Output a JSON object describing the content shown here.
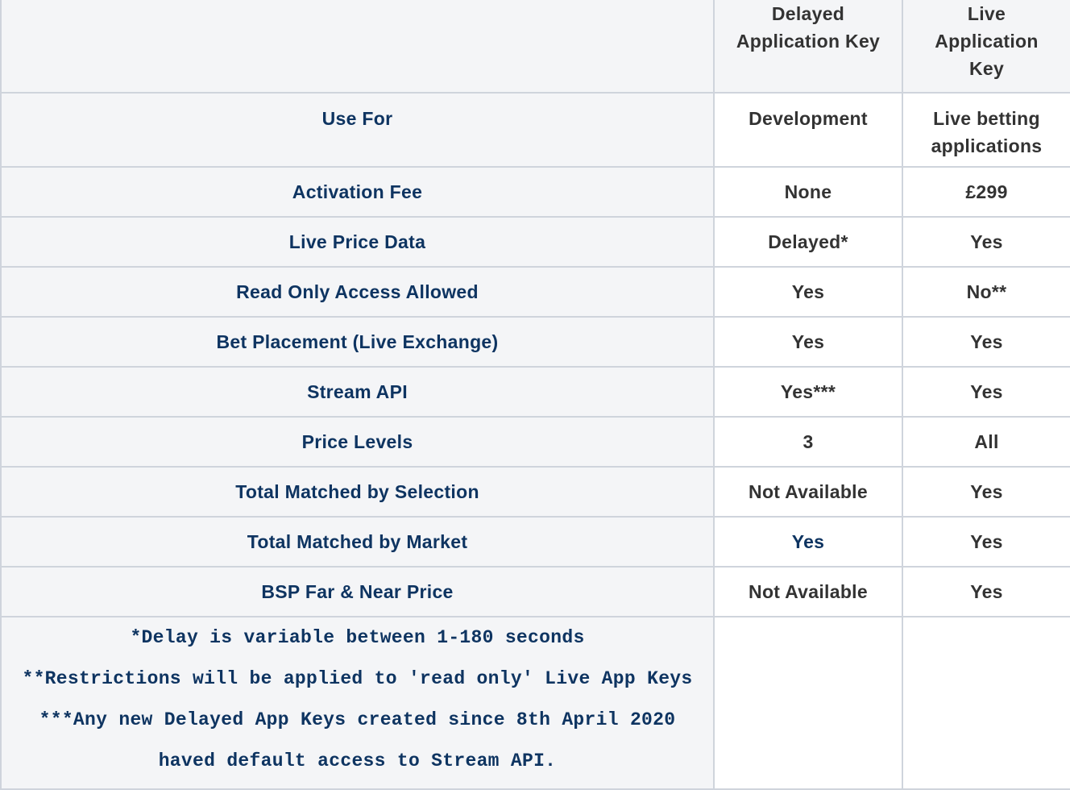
{
  "table": {
    "headers": {
      "corner": "",
      "delayed": [
        "Delayed",
        "Application Key"
      ],
      "live": [
        "Live",
        "Application",
        "Key"
      ]
    },
    "use_for": {
      "label": "Use For",
      "delayed": "Development",
      "live": [
        "Live betting",
        "applications"
      ]
    },
    "rows": [
      {
        "label": "Activation Fee",
        "delayed": "None",
        "live": "£299"
      },
      {
        "label": "Live Price Data",
        "delayed": "Delayed*",
        "live": "Yes"
      },
      {
        "label": "Read Only Access Allowed",
        "delayed": "Yes",
        "live": "No**"
      },
      {
        "label": "Bet Placement (Live Exchange)",
        "delayed": "Yes",
        "live": "Yes"
      },
      {
        "label": "Stream API",
        "delayed": "Yes***",
        "live": "Yes"
      },
      {
        "label": "Price Levels",
        "delayed": "3",
        "live": "All"
      },
      {
        "label": "Total Matched by Selection",
        "delayed": "Not Available",
        "live": "Yes"
      },
      {
        "label": "Total Matched by Market",
        "delayed": "Yes",
        "live": "Yes"
      },
      {
        "label": "BSP Far & Near Price",
        "delayed": "Not Available",
        "live": "Yes"
      }
    ],
    "notes": [
      "*Delay is variable between 1-180 seconds",
      "**Restrictions will be applied to 'read only' Live App Keys",
      "***Any new Delayed App Keys created since 8th April 2020",
      "haved default access to Stream API."
    ]
  },
  "colors": {
    "label_text": "#0e3461",
    "value_text": "#333333",
    "header_bg": "#f4f5f7",
    "border": "#cfd4dc"
  }
}
